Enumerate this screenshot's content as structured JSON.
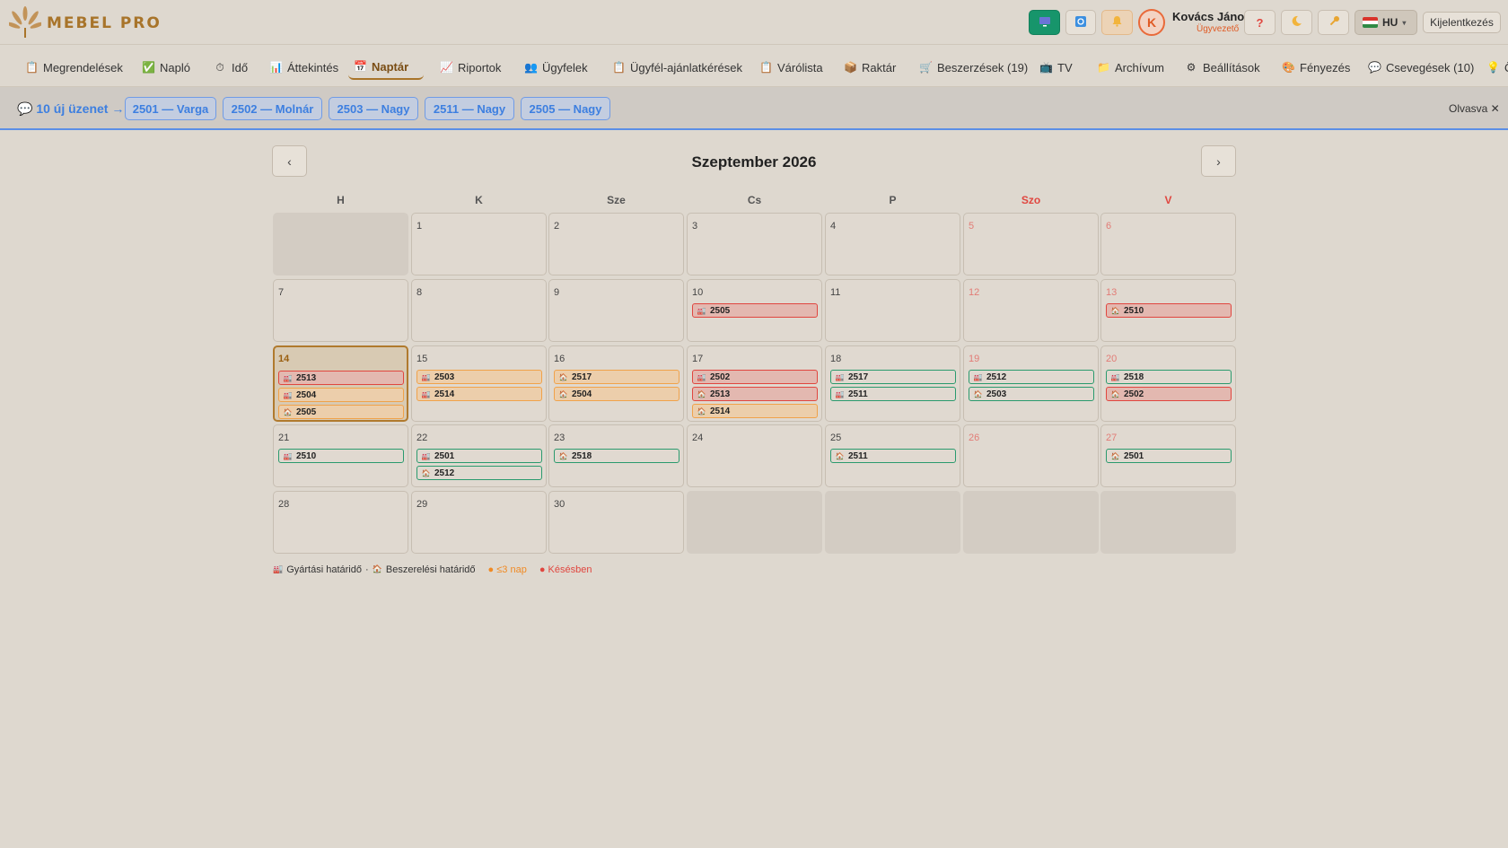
{
  "header": {
    "brand": "MEBEL PRO",
    "user_initial": "K",
    "user_name": "Kovács János",
    "user_role": "Ügyvezető",
    "language": "HU",
    "logout": "Kijelentkezés",
    "accent_color": "#a8742a",
    "icons": [
      "tv-screen-icon",
      "refresh-icon",
      "bell-icon",
      "help-icon",
      "theme-moon-icon",
      "key-icon"
    ]
  },
  "nav": {
    "items": [
      {
        "label": "Megrendelések",
        "icon": "clipboard-icon",
        "glyph": "📋"
      },
      {
        "label": "Napló",
        "icon": "checkbox-icon",
        "glyph": "✅"
      },
      {
        "label": "Idő",
        "icon": "stopwatch-icon",
        "glyph": "⏱"
      },
      {
        "label": "Áttekintés",
        "icon": "bar-chart-icon",
        "glyph": "📊"
      },
      {
        "label": "Naptár",
        "icon": "calendar-icon",
        "glyph": "📅"
      },
      {
        "label": "Riportok",
        "icon": "line-chart-icon",
        "glyph": "📈"
      },
      {
        "label": "Ügyfelek",
        "icon": "people-icon",
        "glyph": "👥"
      },
      {
        "label": "Ügyfél-ajánlatkérések",
        "icon": "clipboard-icon",
        "glyph": "📋"
      },
      {
        "label": "Várólista",
        "icon": "clipboard-icon",
        "glyph": "📋"
      },
      {
        "label": "Raktár",
        "icon": "package-icon",
        "glyph": "📦"
      },
      {
        "label": "Beszerzések (19)",
        "icon": "cart-icon",
        "glyph": "🛒"
      },
      {
        "label": "TV",
        "icon": "tv-icon",
        "glyph": "📺"
      },
      {
        "label": "Archívum",
        "icon": "folder-icon",
        "glyph": "📁"
      },
      {
        "label": "Beállítások",
        "icon": "settings-icon",
        "glyph": "⚙"
      },
      {
        "label": "Fényezés",
        "icon": "paint-icon",
        "glyph": "🎨"
      },
      {
        "label": "Csevegések (10)",
        "icon": "chat-icon",
        "glyph": "💬"
      },
      {
        "label": "Ö",
        "icon": "bulb-icon",
        "glyph": "💡"
      }
    ],
    "active": "Naptár"
  },
  "messages": {
    "lead": "💬 10 új üzenet →",
    "chips": [
      "2501 — Varga",
      "2502 — Molnár",
      "2503 — Nagy",
      "2511 — Nagy",
      "2505 — Nagy"
    ],
    "read": "Olvasva ✕"
  },
  "calendar": {
    "title": "Szeptember 2026",
    "prev": "‹",
    "next": "›",
    "weekdays": [
      "H",
      "K",
      "Sze",
      "Cs",
      "P",
      "Szo",
      "V"
    ],
    "weeks": [
      [
        null,
        {
          "day": "1",
          "events": []
        },
        {
          "day": "2",
          "events": []
        },
        {
          "day": "3",
          "events": []
        },
        {
          "day": "4",
          "events": []
        },
        {
          "day": "5",
          "events": []
        },
        {
          "day": "6",
          "events": []
        }
      ],
      [
        {
          "day": "7",
          "events": []
        },
        {
          "day": "8",
          "events": []
        },
        {
          "day": "9",
          "events": []
        },
        {
          "day": "10",
          "events": [
            {
              "id": "2505",
              "kind": "production",
              "status": "red"
            }
          ]
        },
        {
          "day": "11",
          "events": []
        },
        {
          "day": "12",
          "events": []
        },
        {
          "day": "13",
          "events": [
            {
              "id": "2510",
              "kind": "purchase",
              "status": "red"
            }
          ]
        }
      ],
      [
        {
          "day": "14",
          "today": true,
          "events": [
            {
              "id": "2513",
              "kind": "production",
              "status": "red"
            },
            {
              "id": "2504",
              "kind": "production",
              "status": "orange"
            },
            {
              "id": "2505",
              "kind": "purchase",
              "status": "orange"
            }
          ]
        },
        {
          "day": "15",
          "events": [
            {
              "id": "2503",
              "kind": "production",
              "status": "orange"
            },
            {
              "id": "2514",
              "kind": "production",
              "status": "orange"
            }
          ]
        },
        {
          "day": "16",
          "events": [
            {
              "id": "2517",
              "kind": "purchase",
              "status": "orange"
            },
            {
              "id": "2504",
              "kind": "purchase",
              "status": "orange"
            }
          ]
        },
        {
          "day": "17",
          "events": [
            {
              "id": "2502",
              "kind": "production",
              "status": "red"
            },
            {
              "id": "2513",
              "kind": "purchase",
              "status": "red"
            },
            {
              "id": "2514",
              "kind": "purchase",
              "status": "orange"
            }
          ]
        },
        {
          "day": "18",
          "events": [
            {
              "id": "2517",
              "kind": "production",
              "status": "green"
            },
            {
              "id": "2511",
              "kind": "production",
              "status": "green"
            }
          ]
        },
        {
          "day": "19",
          "events": [
            {
              "id": "2512",
              "kind": "production",
              "status": "green"
            },
            {
              "id": "2503",
              "kind": "purchase",
              "status": "green"
            }
          ]
        },
        {
          "day": "20",
          "events": [
            {
              "id": "2518",
              "kind": "production",
              "status": "green"
            },
            {
              "id": "2502",
              "kind": "purchase",
              "status": "red"
            }
          ]
        }
      ],
      [
        {
          "day": "21",
          "events": [
            {
              "id": "2510",
              "kind": "production",
              "status": "green"
            }
          ]
        },
        {
          "day": "22",
          "events": [
            {
              "id": "2501",
              "kind": "production",
              "status": "green"
            },
            {
              "id": "2512",
              "kind": "purchase",
              "status": "green"
            }
          ]
        },
        {
          "day": "23",
          "events": [
            {
              "id": "2518",
              "kind": "purchase",
              "status": "green"
            }
          ]
        },
        {
          "day": "24",
          "events": []
        },
        {
          "day": "25",
          "events": [
            {
              "id": "2511",
              "kind": "purchase",
              "status": "green"
            }
          ]
        },
        {
          "day": "26",
          "events": []
        },
        {
          "day": "27",
          "events": [
            {
              "id": "2501",
              "kind": "purchase",
              "status": "green"
            }
          ]
        }
      ],
      [
        {
          "day": "28",
          "events": []
        },
        {
          "day": "29",
          "events": []
        },
        {
          "day": "30",
          "events": []
        },
        null,
        null,
        null,
        null
      ]
    ]
  },
  "legend": {
    "production": "Gyártási határidő",
    "separator": "·",
    "purchase": "Beszerelési határidő",
    "soon": "● ≤3 nap",
    "late": "● Késésben"
  }
}
